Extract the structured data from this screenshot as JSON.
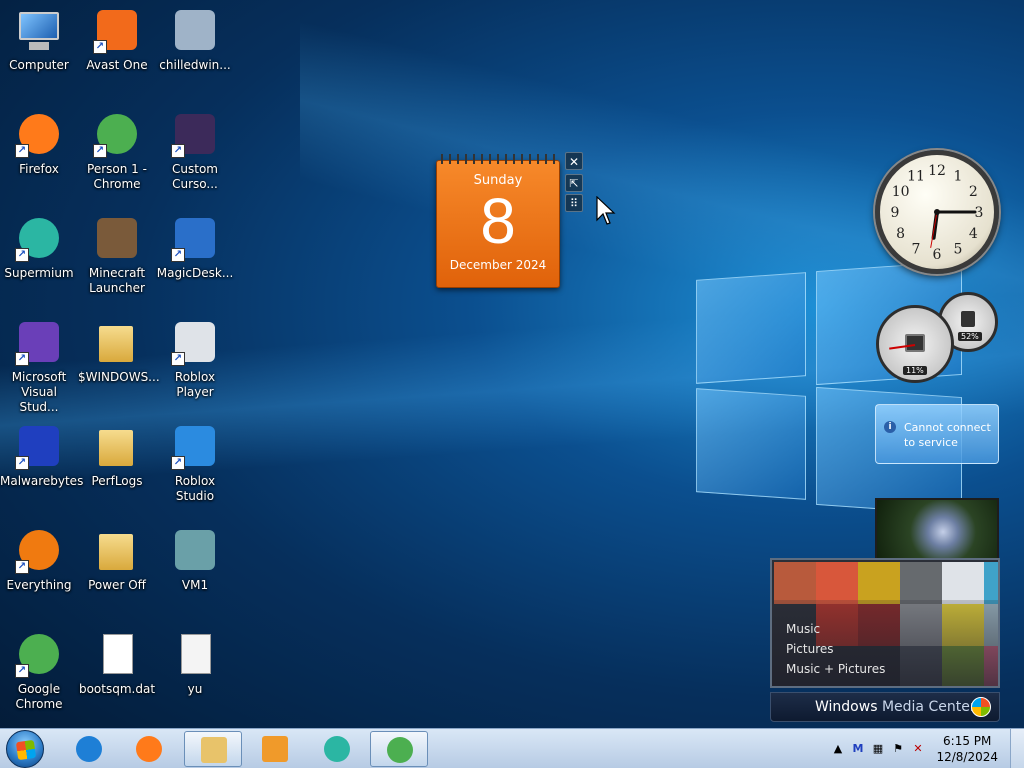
{
  "desktop": {
    "icons": [
      {
        "label": "Computer",
        "icon": "computer-icon",
        "shortcut": false
      },
      {
        "label": "Avast One",
        "icon": "avast-icon",
        "shortcut": true
      },
      {
        "label": "chilledwin...",
        "icon": "window-app-icon",
        "shortcut": false
      },
      {
        "label": "Firefox",
        "icon": "firefox-icon",
        "shortcut": true
      },
      {
        "label": "Person 1 - Chrome",
        "icon": "chrome-profile-icon",
        "shortcut": true
      },
      {
        "label": "Custom Curso...",
        "icon": "custom-cursor-icon",
        "shortcut": true
      },
      {
        "label": "Supermium",
        "icon": "supermium-icon",
        "shortcut": true
      },
      {
        "label": "Minecraft Launcher",
        "icon": "minecraft-icon",
        "shortcut": false
      },
      {
        "label": "MagicDesk...",
        "icon": "magicdesk-icon",
        "shortcut": true
      },
      {
        "label": "Microsoft Visual Stud...",
        "icon": "visual-studio-icon",
        "shortcut": true
      },
      {
        "label": "$WINDOWS...",
        "icon": "folder-icon",
        "shortcut": false
      },
      {
        "label": "Roblox Player",
        "icon": "roblox-icon",
        "shortcut": true
      },
      {
        "label": "Malwarebytes",
        "icon": "malwarebytes-icon",
        "shortcut": true
      },
      {
        "label": "PerfLogs",
        "icon": "folder-icon",
        "shortcut": false
      },
      {
        "label": "Roblox Studio",
        "icon": "roblox-studio-icon",
        "shortcut": true
      },
      {
        "label": "Everything",
        "icon": "everything-icon",
        "shortcut": true
      },
      {
        "label": "Power Off",
        "icon": "folder-icon",
        "shortcut": false
      },
      {
        "label": "VM1",
        "icon": "vm-icon",
        "shortcut": false
      },
      {
        "label": "Google Chrome",
        "icon": "chrome-icon",
        "shortcut": true
      },
      {
        "label": "bootsqm.dat",
        "icon": "file-icon",
        "shortcut": false
      },
      {
        "label": "yu",
        "icon": "text-file-icon",
        "shortcut": false
      }
    ]
  },
  "calendar": {
    "weekday": "Sunday",
    "day": "8",
    "month_year": "December 2024"
  },
  "calendar_controls": {
    "close": "✕",
    "resize": "⇱",
    "drag": "⠿"
  },
  "clock_gadget": {
    "numerals": [
      "12",
      "1",
      "2",
      "3",
      "4",
      "5",
      "6",
      "7",
      "8",
      "9",
      "10",
      "11"
    ],
    "hour_hand": 6.25,
    "minute_hand": 15
  },
  "cpu_meter": {
    "cpu_percent_label": "11%",
    "memory_percent_label": "52%",
    "cpu_value": 11,
    "memory_value": 52
  },
  "weather": {
    "info": "i",
    "message_line1": "Cannot connect",
    "message_line2": "to service"
  },
  "media_center": {
    "menu": [
      "Music",
      "Pictures",
      "Music + Pictures"
    ],
    "brand_bold": "Windows",
    "brand_light": " Media Center"
  },
  "taskbar": {
    "pinned": [
      {
        "name": "taskbar-ie",
        "icon": "internet-explorer-icon",
        "color": "#1e7fd6"
      },
      {
        "name": "taskbar-firefox",
        "icon": "firefox-icon",
        "color": "#ff7a1a"
      },
      {
        "name": "taskbar-explorer",
        "icon": "file-explorer-icon",
        "color": "#e8c36a"
      },
      {
        "name": "taskbar-media-player",
        "icon": "media-player-icon",
        "color": "#f09a2a"
      },
      {
        "name": "taskbar-supermium",
        "icon": "supermium-icon",
        "color": "#2bb6a3"
      },
      {
        "name": "taskbar-chrome",
        "icon": "chrome-icon",
        "color": "#4caf50"
      }
    ],
    "time": "6:15 PM",
    "date": "12/8/2024"
  },
  "colors": {
    "calendar_orange": "#e8731a",
    "taskbar_blue": "#c6d8ee"
  }
}
